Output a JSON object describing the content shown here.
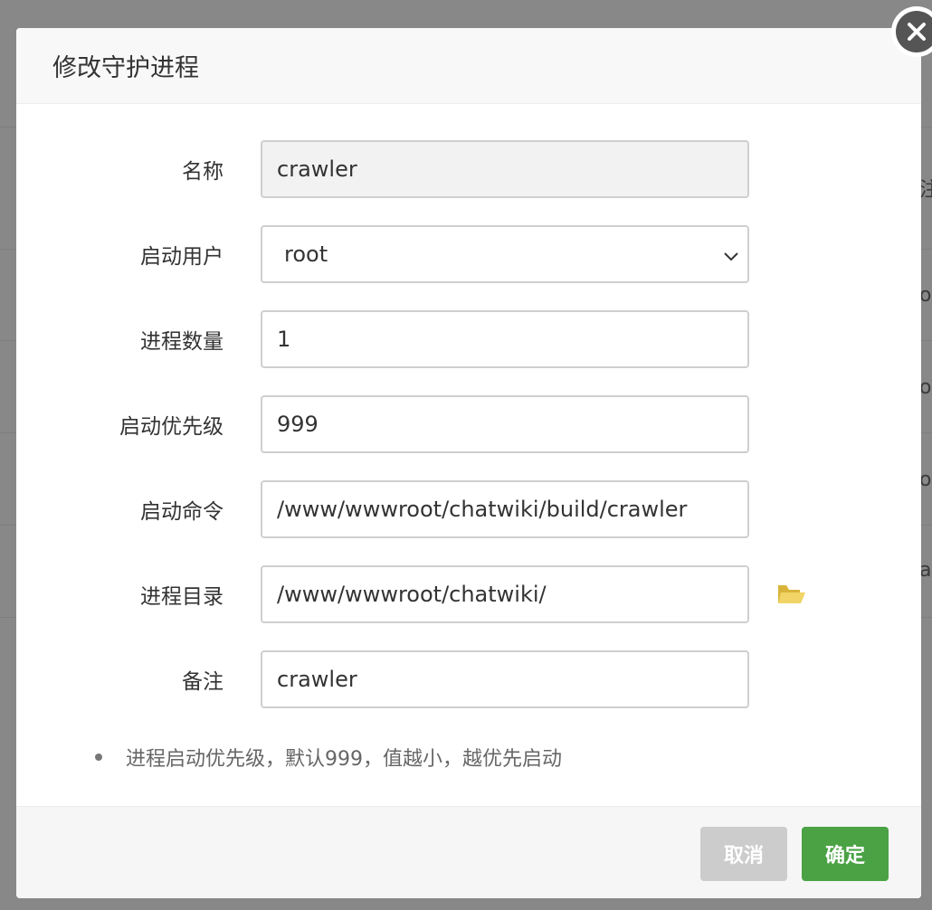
{
  "background": {
    "edge_chars": [
      "注",
      "o-",
      "o-",
      "o-",
      "a"
    ]
  },
  "dialog": {
    "title": "修改守护进程",
    "close_icon": "close-icon"
  },
  "form": {
    "name": {
      "label": "名称",
      "value": "crawler"
    },
    "user": {
      "label": "启动用户",
      "value": "root"
    },
    "process_count": {
      "label": "进程数量",
      "value": "1"
    },
    "priority": {
      "label": "启动优先级",
      "value": "999"
    },
    "command": {
      "label": "启动命令",
      "value": "/www/wwwroot/chatwiki/build/crawler"
    },
    "directory": {
      "label": "进程目录",
      "value": "/www/wwwroot/chatwiki/",
      "icon": "folder-open-icon"
    },
    "remark": {
      "label": "备注",
      "value": "crawler"
    }
  },
  "tip": "进程启动优先级，默认999，值越小，越优先启动",
  "footer": {
    "cancel_label": "取消",
    "confirm_label": "确定"
  },
  "colors": {
    "confirm": "#4aa244",
    "cancel": "#cccccc",
    "folder": "#e8c74f"
  }
}
